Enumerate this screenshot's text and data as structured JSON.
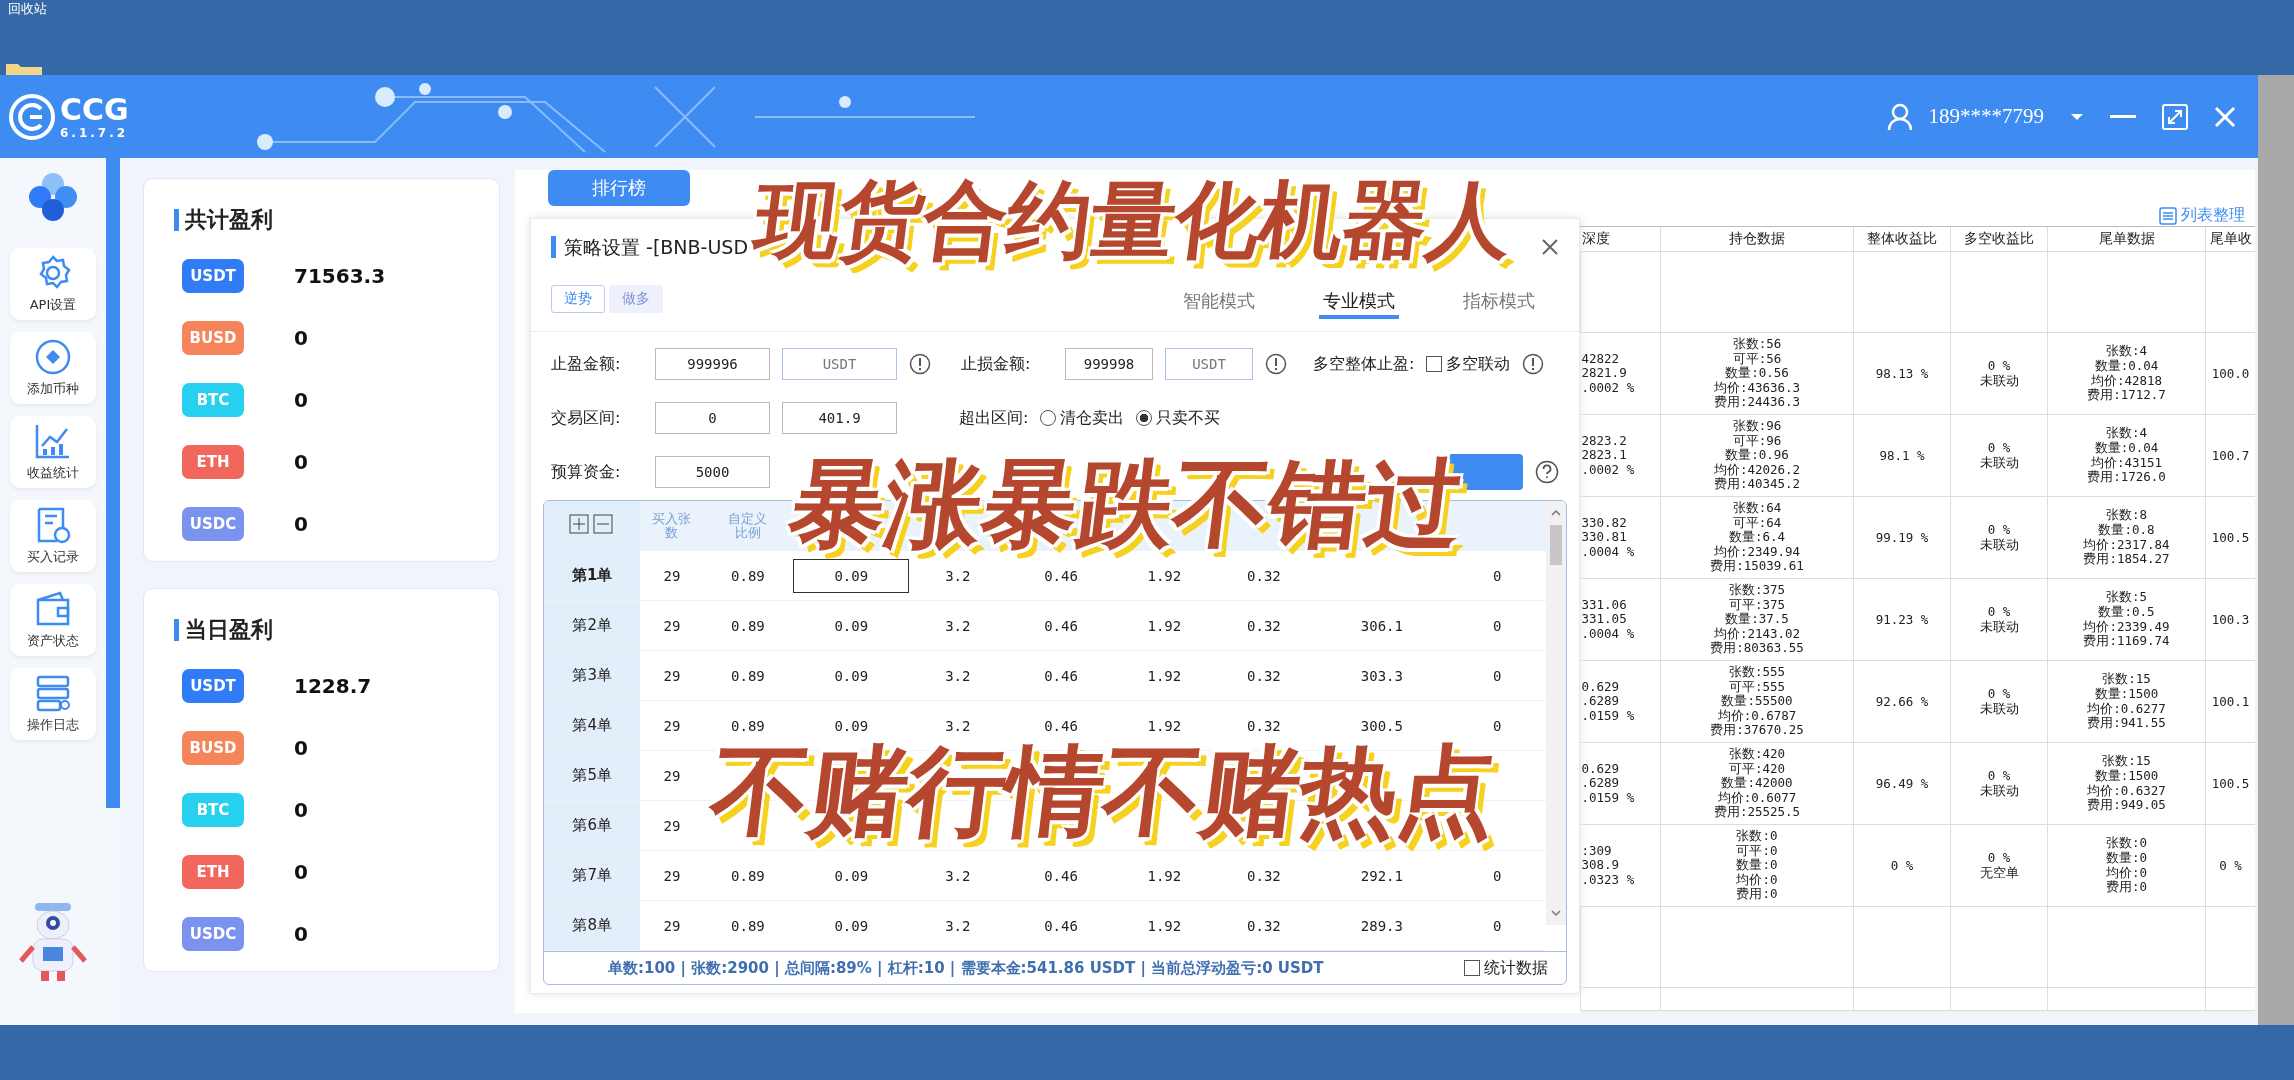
{
  "desktop": {
    "icon_label": "回收站"
  },
  "window": {
    "logo": "CCG",
    "version": "6.1.7.2",
    "user": "189****7799"
  },
  "sidebar": {
    "items": [
      {
        "label": "API设置"
      },
      {
        "label": "添加币种"
      },
      {
        "label": "收益统计"
      },
      {
        "label": "买入记录"
      },
      {
        "label": "资产状态"
      },
      {
        "label": "操作日志"
      }
    ]
  },
  "profit_cards": [
    {
      "title": "共计盈利",
      "rows": [
        {
          "coin": "USDT",
          "value": "71563.3",
          "color": "#2f7cf6"
        },
        {
          "coin": "BUSD",
          "value": "0",
          "color": "#f5845a"
        },
        {
          "coin": "BTC",
          "value": "0",
          "color": "#27d0ef"
        },
        {
          "coin": "ETH",
          "value": "0",
          "color": "#f2675c"
        },
        {
          "coin": "USDC",
          "value": "0",
          "color": "#7b93ef"
        }
      ]
    },
    {
      "title": "当日盈利",
      "rows": [
        {
          "coin": "USDT",
          "value": "1228.7",
          "color": "#2f7cf6"
        },
        {
          "coin": "BUSD",
          "value": "0",
          "color": "#f5845a"
        },
        {
          "coin": "BTC",
          "value": "0",
          "color": "#27d0ef"
        },
        {
          "coin": "ETH",
          "value": "0",
          "color": "#f2675c"
        },
        {
          "coin": "USDC",
          "value": "0",
          "color": "#7b93ef"
        }
      ]
    }
  ],
  "ranking_button": "排行榜",
  "list_settings_link": "列表整理",
  "strategy_dialog": {
    "title": "策略设置 -[BNB-USD",
    "direction_tabs": [
      {
        "label": "逆势",
        "selected": true
      },
      {
        "label": "做多",
        "selected": false
      }
    ],
    "mode_tabs": [
      {
        "label": "智能模式",
        "selected": false
      },
      {
        "label": "专业模式",
        "selected": true
      },
      {
        "label": "指标模式",
        "selected": false
      }
    ],
    "take_profit": {
      "label": "止盈金额:",
      "value": "999996",
      "unit": "USDT"
    },
    "stop_loss": {
      "label": "止损金额:",
      "value": "999998",
      "unit": "USDT"
    },
    "overall_take_profit": {
      "label": "多空整体止盈:",
      "checkbox": "多空联动",
      "checked": false
    },
    "trade_range": {
      "label": "交易区间:",
      "low": "0",
      "high": "401.9"
    },
    "out_of_range": {
      "label": "超出区间:",
      "options": [
        {
          "label": "清仓卖出",
          "selected": false
        },
        {
          "label": "只卖不买",
          "selected": true
        }
      ]
    },
    "budget": {
      "label": "预算资金:",
      "value": "5000"
    },
    "table": {
      "columns": [
        "买入张数",
        "自定义比例"
      ],
      "rows": [
        {
          "label": "第1单",
          "selected": true,
          "cells": [
            "29",
            "0.89",
            {
              "value": "0.09",
              "editing": true
            },
            "3.2",
            "0.46",
            "1.92",
            "0.32",
            null,
            "0"
          ]
        },
        {
          "label": "第2单",
          "selected": false,
          "cells": [
            "29",
            "0.89",
            "0.09",
            "3.2",
            "0.46",
            "1.92",
            "0.32",
            "306.1",
            "0"
          ]
        },
        {
          "label": "第3单",
          "selected": false,
          "cells": [
            "29",
            "0.89",
            "0.09",
            "3.2",
            "0.46",
            "1.92",
            "0.32",
            "303.3",
            "0"
          ]
        },
        {
          "label": "第4单",
          "selected": false,
          "cells": [
            "29",
            "0.89",
            "0.09",
            "3.2",
            "0.46",
            "1.92",
            "0.32",
            "300.5",
            "0"
          ]
        },
        {
          "label": "第5单",
          "selected": false,
          "cells": [
            "29",
            null,
            null,
            null,
            null,
            null,
            null,
            null,
            null
          ]
        },
        {
          "label": "第6单",
          "selected": false,
          "cells": [
            "29",
            null,
            null,
            null,
            null,
            null,
            null,
            null,
            null
          ]
        },
        {
          "label": "第7单",
          "selected": false,
          "cells": [
            "29",
            "0.89",
            "0.09",
            "3.2",
            "0.46",
            "1.92",
            "0.32",
            "292.1",
            "0"
          ]
        },
        {
          "label": "第8单",
          "selected": false,
          "cells": [
            "29",
            "0.89",
            "0.09",
            "3.2",
            "0.46",
            "1.92",
            "0.32",
            "289.3",
            "0"
          ]
        }
      ]
    },
    "footer": {
      "summary": "单数:100  |  张数:2900  |  总间隔:89%  |  杠杆:10  |  需要本金:541.86 USDT  |  当前总浮动盈亏:0 USDT",
      "checkbox": {
        "label": "统计数据",
        "checked": false
      }
    }
  },
  "positions_table": {
    "columns": [
      "深度",
      "持仓数据",
      "整体收益比",
      "多空收益比",
      "尾单数据",
      "尾单收"
    ],
    "rows": [
      {
        "column_1": [
          "42822",
          "2821.9",
          ".0002 %"
        ],
        "holding": [
          "张数:56",
          "可平:56",
          "数量:0.56",
          "均价:43636.3",
          "费用:24436.3"
        ],
        "overall": "98.13 %",
        "long_short": [
          "0 %",
          "未联动"
        ],
        "tail": [
          "张数:4",
          "数量:0.04",
          "均价:42818",
          "费用:1712.7"
        ],
        "tail_return": "100.0"
      },
      {
        "column_1": [
          "2823.2",
          "2823.1",
          ".0002 %"
        ],
        "holding": [
          "张数:96",
          "可平:96",
          "数量:0.96",
          "均价:42026.2",
          "费用:40345.2"
        ],
        "overall": "98.1 %",
        "long_short": [
          "0 %",
          "未联动"
        ],
        "tail": [
          "张数:4",
          "数量:0.04",
          "均价:43151",
          "费用:1726.0"
        ],
        "tail_return": "100.7"
      },
      {
        "column_1": [
          "330.82",
          "330.81",
          ".0004 %"
        ],
        "holding": [
          "张数:64",
          "可平:64",
          "数量:6.4",
          "均价:2349.94",
          "费用:15039.61"
        ],
        "overall": "99.19 %",
        "long_short": [
          "0 %",
          "未联动"
        ],
        "tail": [
          "张数:8",
          "数量:0.8",
          "均价:2317.84",
          "费用:1854.27"
        ],
        "tail_return": "100.5"
      },
      {
        "column_1": [
          "331.06",
          "331.05",
          ".0004 %"
        ],
        "holding": [
          "张数:375",
          "可平:375",
          "数量:37.5",
          "均价:2143.02",
          "费用:80363.55"
        ],
        "overall": "91.23 %",
        "long_short": [
          "0 %",
          "未联动"
        ],
        "tail": [
          "张数:5",
          "数量:0.5",
          "均价:2339.49",
          "费用:1169.74"
        ],
        "tail_return": "100.3"
      },
      {
        "column_1": [
          "0.629",
          ".6289",
          ".0159 %"
        ],
        "holding": [
          "张数:555",
          "可平:555",
          "数量:55500",
          "均价:0.6787",
          "费用:37670.25"
        ],
        "overall": "92.66 %",
        "long_short": [
          "0 %",
          "未联动"
        ],
        "tail": [
          "张数:15",
          "数量:1500",
          "均价:0.6277",
          "费用:941.55"
        ],
        "tail_return": "100.1"
      },
      {
        "column_1": [
          "0.629",
          ".6289",
          ".0159 %"
        ],
        "holding": [
          "张数:420",
          "可平:420",
          "数量:42000",
          "均价:0.6077",
          "费用:25525.5"
        ],
        "overall": "96.49 %",
        "long_short": [
          "0 %",
          "未联动"
        ],
        "tail": [
          "张数:15",
          "数量:1500",
          "均价:0.6327",
          "费用:949.05"
        ],
        "tail_return": "100.5"
      },
      {
        "column_1": [
          ":309",
          "308.9",
          ".0323 %"
        ],
        "holding": [
          "张数:0",
          "可平:0",
          "数量:0",
          "均价:0",
          "费用:0"
        ],
        "overall": "0 %",
        "long_short": [
          "0 %",
          "无空单"
        ],
        "tail": [
          "张数:0",
          "数量:0",
          "均价:0",
          "费用:0"
        ],
        "tail_return": "0 %"
      }
    ]
  },
  "overlay_captions": [
    "现货合约量化机器人",
    "暴涨暴跌不错过",
    "不赌行情不赌热点"
  ]
}
